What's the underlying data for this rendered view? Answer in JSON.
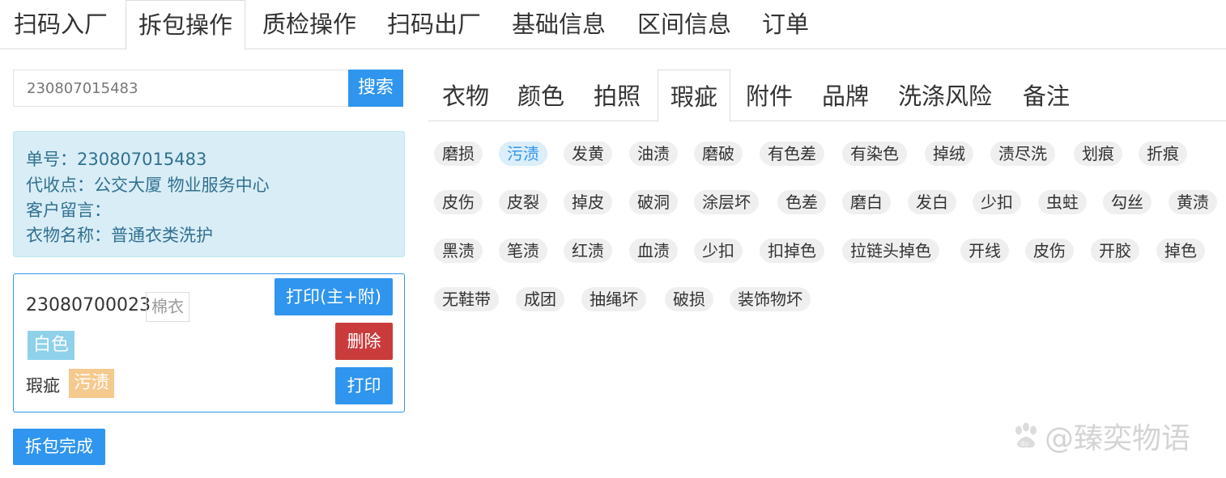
{
  "top_tabs": [
    {
      "label": "扫码入厂",
      "active": false
    },
    {
      "label": "拆包操作",
      "active": true
    },
    {
      "label": "质检操作",
      "active": false
    },
    {
      "label": "扫码出厂",
      "active": false
    },
    {
      "label": "基础信息",
      "active": false
    },
    {
      "label": "区间信息",
      "active": false
    },
    {
      "label": "订单",
      "active": false
    }
  ],
  "search": {
    "value": "230807015483",
    "button_label": "搜索"
  },
  "order_info": {
    "order_no": "单号：230807015483",
    "collection_point": "代收点：公交大厦 物业服务中心",
    "customer_note": "客户留言：",
    "item_name": "衣物名称：普通衣类洗护"
  },
  "item": {
    "number": "23080700023",
    "type": "棉衣",
    "color": "白色",
    "defect_title": "瑕疵",
    "defect": "污渍",
    "print_main_label": "打印(主+附)",
    "delete_label": "删除",
    "print_label": "打印"
  },
  "finish_button_label": "拆包完成",
  "category_tabs": [
    {
      "label": "衣物",
      "active": false
    },
    {
      "label": "颜色",
      "active": false
    },
    {
      "label": "拍照",
      "active": false
    },
    {
      "label": "瑕疵",
      "active": true
    },
    {
      "label": "附件",
      "active": false
    },
    {
      "label": "品牌",
      "active": false
    },
    {
      "label": "洗涤风险",
      "active": false
    },
    {
      "label": "备注",
      "active": false
    }
  ],
  "defect_rows": [
    [
      "磨损",
      "污渍",
      "发黄",
      "油渍",
      "磨破",
      "有色差",
      "有染色",
      "掉绒",
      "渍尽洗",
      "划痕",
      "折痕"
    ],
    [
      "皮伤",
      "皮裂",
      "掉皮",
      "破洞",
      "涂层坏",
      "色差",
      "磨白",
      "发白",
      "少扣",
      "虫蛀",
      "勾丝",
      "黄渍"
    ],
    [
      "黑渍",
      "笔渍",
      "红渍",
      "血渍",
      "少扣",
      "扣掉色",
      "拉链头掉色",
      "开线",
      "皮伤",
      "开胶",
      "掉色"
    ],
    [
      "无鞋带",
      "成团",
      "抽绳坏",
      "破损",
      "装饰物坏"
    ]
  ],
  "selected_defect": "污渍",
  "watermark": "@臻奕物语",
  "colors": {
    "primary": "#2f95ee",
    "danger": "#ca3c3c",
    "info_bg": "#d9edf7",
    "info_text": "#31708f",
    "chip_bg": "#efefef",
    "color_tag": "#8fd1ea",
    "defect_tag": "#f6c98e"
  }
}
